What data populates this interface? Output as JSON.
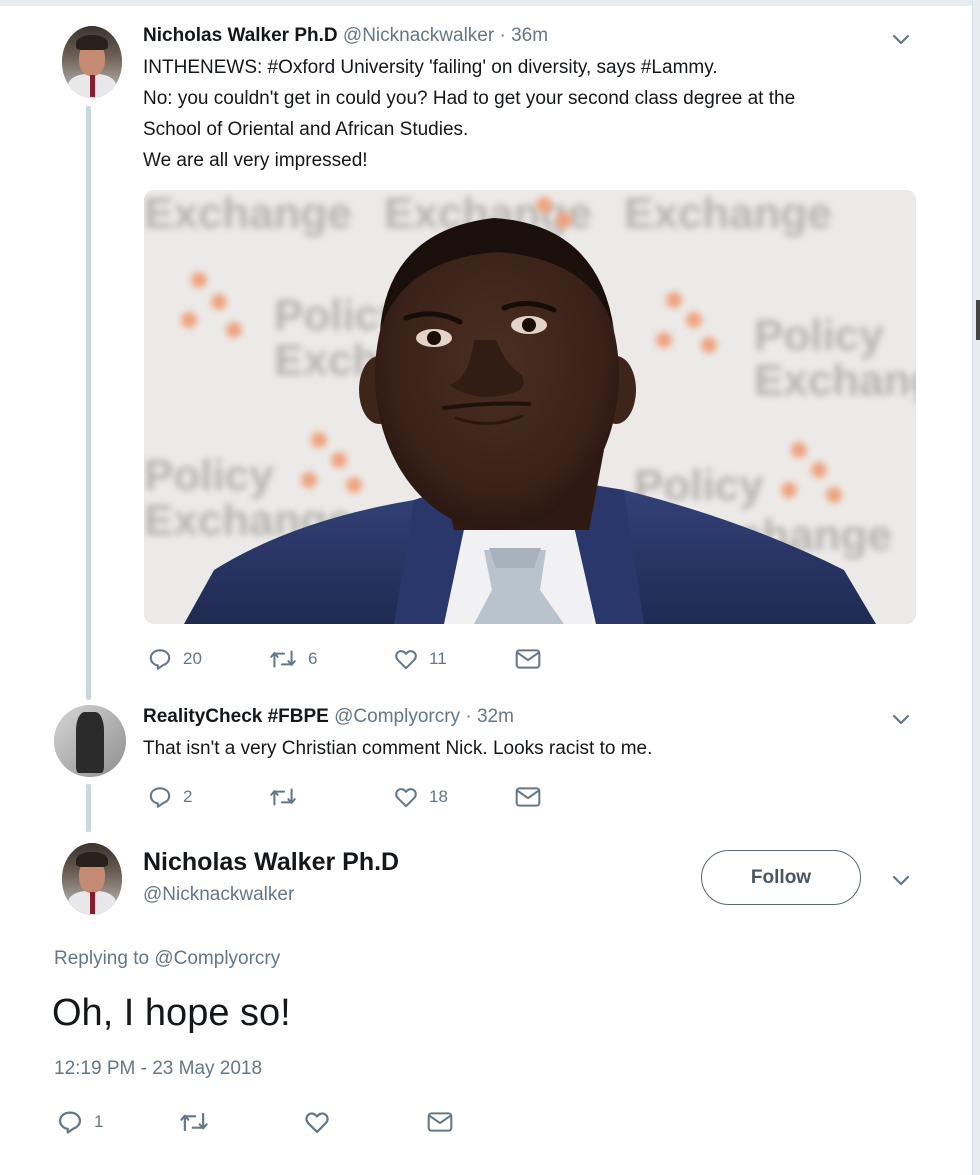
{
  "tweet1": {
    "name": "Nicholas Walker Ph.D",
    "handle": "@Nicknackwalker",
    "time": "· 36m",
    "lines": [
      "INTHENEWS: #Oxford University 'failing' on diversity, says #Lammy.",
      "No: you couldn't get in could you? Had to get your second class degree at the",
      "School of Oriental and African Studies.",
      "We are all very impressed!"
    ],
    "reply_count": "20",
    "retweet_count": "6",
    "like_count": "11",
    "icons": [
      "reply-icon",
      "retweet-icon",
      "like-icon",
      "message-icon",
      "chevron-down-icon"
    ]
  },
  "tweet2": {
    "name": "RealityCheck #FBPE",
    "handle": "@Complyorcry",
    "time": "· 32m",
    "text": "That isn't a very Christian comment Nick.  Looks racist to me.",
    "reply_count": "2",
    "retweet_count": "",
    "like_count": "18"
  },
  "tweet3": {
    "name": "Nicholas Walker Ph.D",
    "handle": "@Nicknackwalker",
    "follow_label": "Follow",
    "replying_prefix": "Replying to",
    "replying_handle": "@Complyorcry",
    "text": "Oh, I hope so!",
    "timestamp": "12:19 PM - 23 May 2018",
    "reply_count": "1",
    "retweet_count": "",
    "like_count": ""
  },
  "photo": {
    "backdrop_text": [
      "Policy",
      "Exchange"
    ]
  },
  "colors": {
    "text": "#14171a",
    "secondary": "#657786",
    "thread_line": "#ccd6dd",
    "suit": "#2c3a66"
  }
}
